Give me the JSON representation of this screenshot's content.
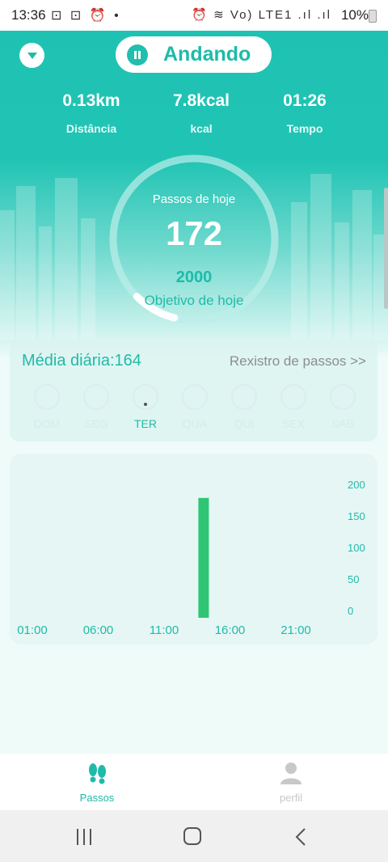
{
  "status_bar": {
    "time": "13:36",
    "left_icons": "⊡ ⊡ ⏰ •",
    "right_icons": "⏰ ≋ Vo) LTE1 .ıl .ıl",
    "battery": "10%"
  },
  "header": {
    "title": "Andando",
    "stats": [
      {
        "value": "0.13km",
        "label": "Distância"
      },
      {
        "value": "7.8kcal",
        "label": "kcal"
      },
      {
        "value": "01:26",
        "label": "Tempo"
      }
    ]
  },
  "ring": {
    "label_top": "Passos de hoje",
    "count": "172",
    "goal": "2000",
    "goal_label": "Objetivo de hoje",
    "progress": 0.086,
    "colors": {
      "track": "#bdeee9",
      "fill": "#ffffff"
    }
  },
  "week": {
    "title": "Média diária:164",
    "link": "Rexistro de passos >>",
    "days": [
      {
        "name": "DOM",
        "active": false
      },
      {
        "name": "SEG",
        "active": false
      },
      {
        "name": "TER",
        "active": true
      },
      {
        "name": "QUA",
        "active": false
      },
      {
        "name": "QUI",
        "active": false
      },
      {
        "name": "SEX",
        "active": false
      },
      {
        "name": "SAB",
        "active": false
      }
    ]
  },
  "chart_data": {
    "type": "bar",
    "x": [
      "01:00",
      "06:00",
      "11:00",
      "16:00",
      "21:00"
    ],
    "bars": [
      {
        "hour": 14,
        "value": 190
      }
    ],
    "ylim": [
      0,
      200
    ],
    "yticks": [
      "200",
      "150",
      "100",
      "50",
      "0"
    ],
    "bar_color": "#2ec675",
    "tick_color": "#1fbba9"
  },
  "bottom_nav": [
    {
      "label": "Passos",
      "icon": "footprints-icon",
      "active": true
    },
    {
      "label": "perfil",
      "icon": "person-icon",
      "active": false
    }
  ],
  "colors": {
    "accent": "#1fbba9",
    "inactive": "#c8c8c8"
  }
}
